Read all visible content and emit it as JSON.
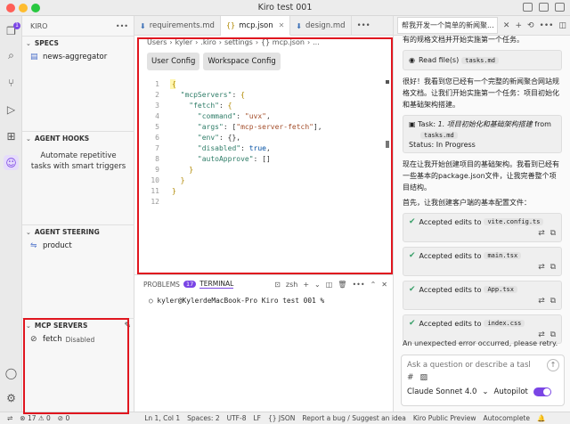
{
  "window": {
    "title": "Kiro test 001"
  },
  "sidebar": {
    "header": "KIRO",
    "specs": {
      "title": "SPECS",
      "items": [
        "news-aggregator"
      ]
    },
    "hooks": {
      "title": "AGENT HOOKS",
      "text": "Automate repetitive tasks with smart triggers"
    },
    "steering": {
      "title": "AGENT STEERING",
      "items": [
        "product"
      ]
    },
    "mcp": {
      "title": "MCP SERVERS",
      "server_name": "fetch",
      "server_status": "Disabled"
    }
  },
  "activity": {
    "badge": "1"
  },
  "tabs": [
    {
      "label": "requirements.md"
    },
    {
      "label": "mcp.json"
    },
    {
      "label": "design.md"
    }
  ],
  "editor": {
    "breadcrumb": [
      "Users",
      "kyler",
      ".kiro",
      "settings",
      "{} mcp.json",
      "..."
    ],
    "buttons": {
      "user": "User Config",
      "workspace": "Workspace Config"
    },
    "lines": [
      "1",
      "2",
      "3",
      "4",
      "5",
      "6",
      "7",
      "8",
      "9",
      "10",
      "11",
      "12"
    ]
  },
  "panel": {
    "problems": "PROBLEMS",
    "problems_count": "17",
    "terminal": "TERMINAL",
    "shell": "zsh",
    "prompt": "kyler@KylerdeMacBook-Pro Kiro test 001 %"
  },
  "chat": {
    "tab_title": "帮我开发一个简单的新闻聚...",
    "top_text": "有的规格文档并开始实施第一个任务。",
    "read_files": "Read file(s)",
    "read_file_pill": "tasks.md",
    "para1": "很好！我看到您已经有一个完整的新闻聚合网站规格文档。让我们开始实施第一个任务：项目初始化和基础架构搭建。",
    "task_label": "Task: ",
    "task_name": "1. 项目初始化和基础架构搭建",
    "task_from": " from",
    "task_pill": "tasks.md",
    "task_status": "Status: In Progress",
    "para2": "现在让我开始创建项目的基础架构。我看到已经有一些基本的package.json文件，让我完善整个项目结构。",
    "para3": "首先，让我创建客户端的基本配置文件：",
    "accepted_label": "Accepted edits to",
    "accepted_files": [
      "vite.config.ts",
      "main.tsx",
      "App.tsx",
      "index.css"
    ],
    "error": "An unexpected error occurred, please retry.",
    "input_placeholder": "Ask a question or describe a task...",
    "model": "Claude Sonnet 4.0",
    "autopilot": "Autopilot"
  },
  "statusbar": {
    "problems": "⊗ 17 ⚠ 0",
    "ports": "⊘ 0",
    "position": "Ln 1, Col 1",
    "spaces": "Spaces: 2",
    "encoding": "UTF-8",
    "eol": "LF",
    "language": "{} JSON",
    "report": "Report a bug / Suggest an idea",
    "preview": "Kiro Public Preview",
    "autocomplete": "Autocomplete"
  }
}
